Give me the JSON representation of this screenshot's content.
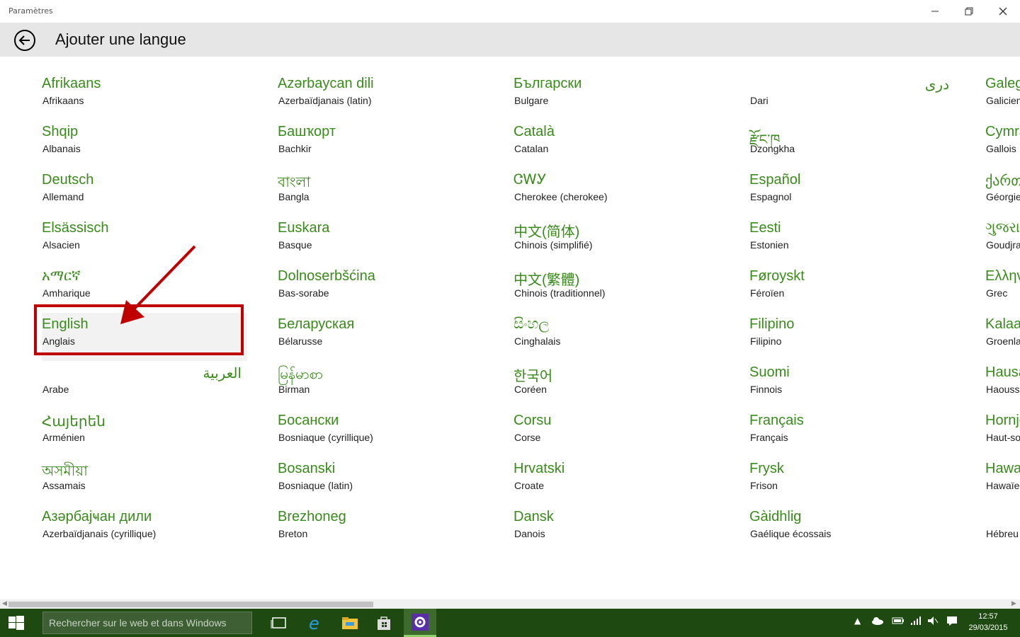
{
  "window": {
    "title": "Paramètres"
  },
  "header": {
    "title": "Ajouter une langue"
  },
  "columns": [
    {
      "items": [
        {
          "native": "Afrikaans",
          "fr": "Afrikaans"
        },
        {
          "native": "Shqip",
          "fr": "Albanais"
        },
        {
          "native": "Deutsch",
          "fr": "Allemand"
        },
        {
          "native": "Elsässisch",
          "fr": "Alsacien"
        },
        {
          "native": "አማርኛ",
          "fr": "Amharique"
        },
        {
          "native": "English",
          "fr": "Anglais"
        },
        {
          "native": "العربية",
          "fr": "Arabe"
        },
        {
          "native": "Հայերեն",
          "fr": "Arménien"
        },
        {
          "native": "অসমীয়া",
          "fr": "Assamais"
        },
        {
          "native": "Азәрбајҹан дили",
          "fr": "Azerbaïdjanais (cyrillique)"
        }
      ]
    },
    {
      "items": [
        {
          "native": "Azərbaycan dili",
          "fr": "Azerbaïdjanais (latin)"
        },
        {
          "native": "Башҡорт",
          "fr": "Bachkir"
        },
        {
          "native": "বাংলা",
          "fr": "Bangla"
        },
        {
          "native": "Euskara",
          "fr": "Basque"
        },
        {
          "native": "Dolnoserbšćina",
          "fr": "Bas-sorabe"
        },
        {
          "native": "Беларуская",
          "fr": "Bélarusse"
        },
        {
          "native": "မြန်မာစာ",
          "fr": "Birman"
        },
        {
          "native": "Босански",
          "fr": "Bosniaque (cyrillique)"
        },
        {
          "native": "Bosanski",
          "fr": "Bosniaque (latin)"
        },
        {
          "native": "Brezhoneg",
          "fr": "Breton"
        }
      ]
    },
    {
      "items": [
        {
          "native": "Български",
          "fr": "Bulgare"
        },
        {
          "native": "Català",
          "fr": "Catalan"
        },
        {
          "native": "ᏣᎳᎩ",
          "fr": "Cherokee (cherokee)"
        },
        {
          "native": "中文(简体)",
          "fr": "Chinois (simplifié)"
        },
        {
          "native": "中文(繁體)",
          "fr": "Chinois (traditionnel)"
        },
        {
          "native": "සිංහල",
          "fr": "Cinghalais"
        },
        {
          "native": "한국어",
          "fr": "Coréen"
        },
        {
          "native": "Corsu",
          "fr": "Corse"
        },
        {
          "native": "Hrvatski",
          "fr": "Croate"
        },
        {
          "native": "Dansk",
          "fr": "Danois"
        }
      ]
    },
    {
      "items": [
        {
          "native": "درى",
          "fr": "Dari"
        },
        {
          "native": "རྫོང་ཁ",
          "fr": "Dzongkha"
        },
        {
          "native": "Español",
          "fr": "Espagnol"
        },
        {
          "native": "Eesti",
          "fr": "Estonien"
        },
        {
          "native": "Føroyskt",
          "fr": "Féroïen"
        },
        {
          "native": "Filipino",
          "fr": "Filipino"
        },
        {
          "native": "Suomi",
          "fr": "Finnois"
        },
        {
          "native": "Français",
          "fr": "Français"
        },
        {
          "native": "Frysk",
          "fr": "Frison"
        },
        {
          "native": "Gàidhlig",
          "fr": "Gaélique écossais"
        }
      ]
    },
    {
      "items": [
        {
          "native": "Galego",
          "fr": "Galicien"
        },
        {
          "native": "Cymraeg",
          "fr": "Gallois"
        },
        {
          "native": "ქართული",
          "fr": "Géorgien"
        },
        {
          "native": "ગુજરાતી",
          "fr": "Goudjrati"
        },
        {
          "native": "Ελληνικά",
          "fr": "Grec"
        },
        {
          "native": "Kalaallisut",
          "fr": "Groenlandais"
        },
        {
          "native": "Hausa",
          "fr": "Haoussa"
        },
        {
          "native": "Hornjoserbšćina",
          "fr": "Haut-sorabe"
        },
        {
          "native": "Hawaiʻi",
          "fr": "Hawaïen"
        },
        {
          "native": "",
          "fr": "Hébreu"
        }
      ]
    }
  ],
  "taskbar": {
    "search_placeholder": "Rechercher sur le web et dans Windows",
    "clock_time": "12:57",
    "clock_date": "29/03/2015"
  },
  "colors": {
    "accent_green": "#3a8a1c",
    "taskbar": "#1e4a12",
    "highlight": "#c00000"
  }
}
